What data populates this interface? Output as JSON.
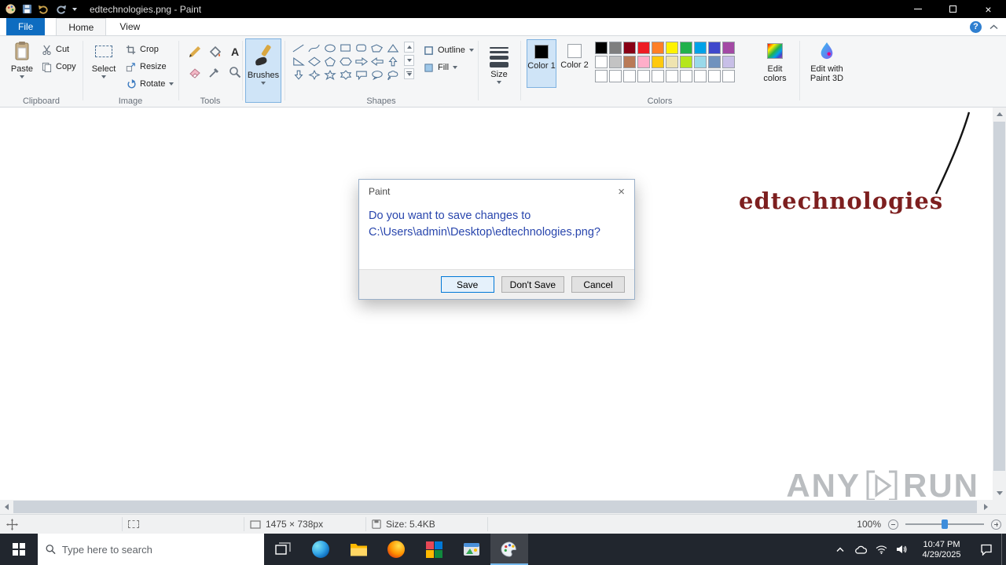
{
  "titlebar": {
    "title": "edtechnologies.png - Paint"
  },
  "glyphs": {
    "close": "×",
    "help": "?",
    "text_tool": "A"
  },
  "tabs": {
    "file": "File",
    "home": "Home",
    "view": "View"
  },
  "ribbon": {
    "clipboard": {
      "label": "Clipboard",
      "paste": "Paste",
      "cut": "Cut",
      "copy": "Copy"
    },
    "image": {
      "label": "Image",
      "select": "Select",
      "crop": "Crop",
      "resize": "Resize",
      "rotate": "Rotate"
    },
    "tools": {
      "label": "Tools"
    },
    "brushes": {
      "label": "Brushes"
    },
    "shapes": {
      "label": "Shapes",
      "outline": "Outline",
      "fill": "Fill"
    },
    "size": {
      "label": "Size"
    },
    "colors": {
      "label": "Colors",
      "color1_label": "Color 1",
      "color2_label": "Color 2",
      "color1_value": [
        "#000000"
      ],
      "color2_value": [
        "#ffffff"
      ],
      "edit_colors": "Edit colors",
      "row1": [
        "#000000",
        "#7f7f7f",
        "#880015",
        "#ed1c24",
        "#ff7f27",
        "#fff200",
        "#22b14c",
        "#00a2e8",
        "#3f48cc",
        "#a349a4"
      ],
      "row2": [
        "#ffffff",
        "#c3c3c3",
        "#b97a57",
        "#ffaec9",
        "#ffc90e",
        "#efe4b0",
        "#b5e61d",
        "#99d9ea",
        "#7092be",
        "#c8bfe7"
      ],
      "row3": [
        "#ffffff",
        "#ffffff",
        "#ffffff",
        "#ffffff",
        "#ffffff",
        "#ffffff",
        "#ffffff",
        "#ffffff",
        "#ffffff",
        "#ffffff"
      ]
    },
    "edit_3d": "Edit with Paint 3D"
  },
  "canvas": {
    "drawing_text": "edtechnologies",
    "drawing_text_color": "#7d1f1f"
  },
  "dialog": {
    "title": "Paint",
    "line1": "Do you want to save changes to",
    "line2": "C:\\Users\\admin\\Desktop\\edtechnologies.png?",
    "save": "Save",
    "dont_save": "Don't Save",
    "cancel": "Cancel"
  },
  "statusbar": {
    "dimensions": "1475 × 738px",
    "file_size": "Size: 5.4KB",
    "zoom": "100%"
  },
  "watermark": {
    "left": "ANY",
    "right": "RUN"
  },
  "taskbar": {
    "search_placeholder": "Type here to search",
    "time": "10:47 PM",
    "date": "4/29/2025"
  }
}
